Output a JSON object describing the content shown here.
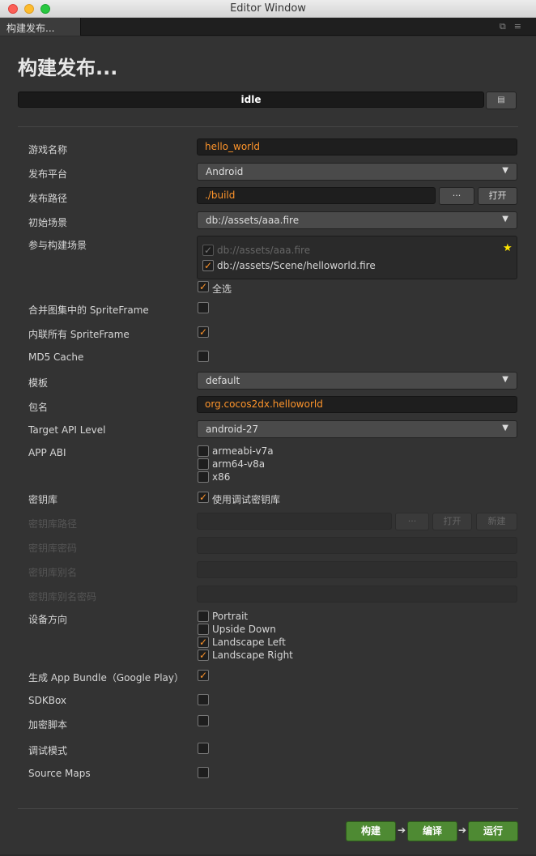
{
  "window": {
    "title": "Editor Window"
  },
  "tab": {
    "label": "构建发布..."
  },
  "page": {
    "title": "构建发布..."
  },
  "status": {
    "text": "idle"
  },
  "fields": {
    "game_name": {
      "label": "游戏名称",
      "value": "hello_world"
    },
    "platform": {
      "label": "发布平台",
      "value": "Android"
    },
    "build_path": {
      "label": "发布路径",
      "value": "./build",
      "browse": "···",
      "open": "打开"
    },
    "start_scene": {
      "label": "初始场景",
      "value": "db://assets/aaa.fire"
    },
    "scenes": {
      "label": "参与构建场景",
      "items": [
        "db://assets/aaa.fire",
        "db://assets/Scene/helloworld.fire"
      ],
      "select_all": "全选"
    },
    "merge_atlas": {
      "label": "合并图集中的 SpriteFrame"
    },
    "inline_sprite": {
      "label": "内联所有 SpriteFrame"
    },
    "md5": {
      "label": "MD5 Cache"
    },
    "template": {
      "label": "模板",
      "value": "default"
    },
    "package": {
      "label": "包名",
      "value": "org.cocos2dx.helloworld"
    },
    "api_level": {
      "label": "Target API Level",
      "value": "android-27"
    },
    "abi": {
      "label": "APP ABI",
      "options": [
        "armeabi-v7a",
        "arm64-v8a",
        "x86"
      ]
    },
    "keystore": {
      "label": "密钥库",
      "option": "使用调试密钥库"
    },
    "keystore_path": {
      "label": "密钥库路径",
      "browse": "···",
      "open": "打开",
      "new": "新建"
    },
    "keystore_pwd": {
      "label": "密钥库密码"
    },
    "keystore_alias": {
      "label": "密钥库别名"
    },
    "keystore_alias_pwd": {
      "label": "密钥库别名密码"
    },
    "orientation": {
      "label": "设备方向",
      "options": [
        "Portrait",
        "Upside Down",
        "Landscape Left",
        "Landscape Right"
      ]
    },
    "app_bundle": {
      "label": "生成 App Bundle（Google Play）"
    },
    "sdkbox": {
      "label": "SDKBox"
    },
    "encrypt": {
      "label": "加密脚本"
    },
    "debug": {
      "label": "调试模式"
    },
    "sourcemaps": {
      "label": "Source Maps"
    }
  },
  "actions": {
    "build": "构建",
    "compile": "编译",
    "run": "运行"
  },
  "colors": {
    "accent": "#fd942b",
    "action_green": "#4e8a33",
    "star": "#ffe600"
  }
}
